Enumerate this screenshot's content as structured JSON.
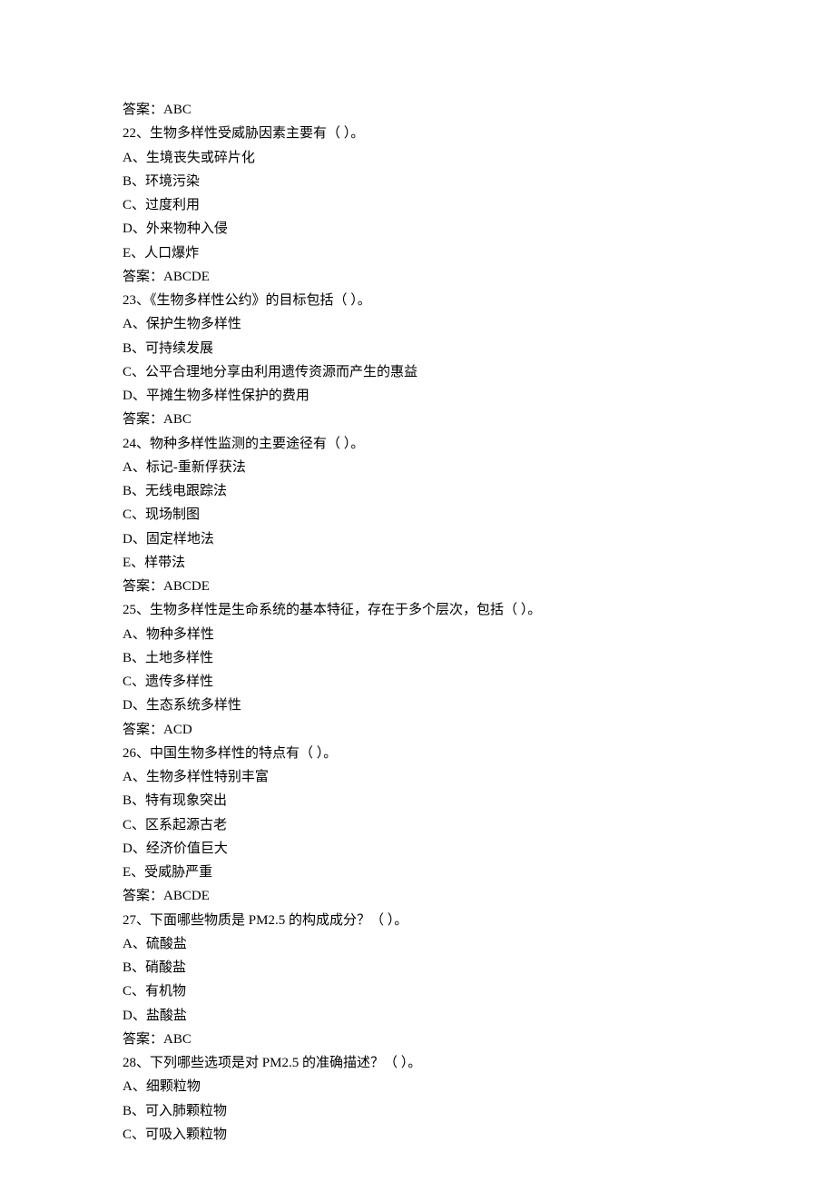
{
  "lines": [
    {
      "text": "答案：ABC"
    },
    {
      "text": "22、生物多样性受威胁因素主要有（ ）。"
    },
    {
      "text": "A、生境丧失或碎片化"
    },
    {
      "text": "B、环境污染"
    },
    {
      "text": "C、过度利用"
    },
    {
      "text": "D、外来物种入侵"
    },
    {
      "text": "E、人口爆炸"
    },
    {
      "text": "答案：ABCDE"
    },
    {
      "text": "23、《生物多样性公约》的目标包括（ ）。"
    },
    {
      "text": "A、保护生物多样性"
    },
    {
      "text": "B、可持续发展"
    },
    {
      "text": "C、公平合理地分享由利用遗传资源而产生的惠益"
    },
    {
      "text": "D、平摊生物多样性保护的费用"
    },
    {
      "text": "答案：ABC"
    },
    {
      "text": "24、物种多样性监测的主要途径有（ ）。"
    },
    {
      "text": "A、标记-重新俘获法"
    },
    {
      "text": "B、无线电跟踪法"
    },
    {
      "text": "C、现场制图"
    },
    {
      "text": "D、固定样地法"
    },
    {
      "text": "E、样带法"
    },
    {
      "text": "答案：ABCDE"
    },
    {
      "text": "25、生物多样性是生命系统的基本特征，存在于多个层次，包括（ ）。"
    },
    {
      "text": "A、物种多样性"
    },
    {
      "text": "B、土地多样性"
    },
    {
      "text": "C、遗传多样性"
    },
    {
      "text": "D、生态系统多样性"
    },
    {
      "text": "答案：ACD"
    },
    {
      "text": "26、中国生物多样性的特点有（ ）。"
    },
    {
      "text": "A、生物多样性特别丰富"
    },
    {
      "text": "B、特有现象突出"
    },
    {
      "text": "C、区系起源古老"
    },
    {
      "text": "D、经济价值巨大"
    },
    {
      "text": "E、受威胁严重"
    },
    {
      "text": "答案：ABCDE"
    },
    {
      "text": "27、下面哪些物质是 PM2.5 的构成成分？（ ）。"
    },
    {
      "text": "A、硫酸盐"
    },
    {
      "text": "B、硝酸盐"
    },
    {
      "text": "C、有机物"
    },
    {
      "text": "D、盐酸盐"
    },
    {
      "text": "答案：ABC"
    },
    {
      "text": "28、下列哪些选项是对 PM2.5 的准确描述？（ ）。"
    },
    {
      "text": "A、细颗粒物"
    },
    {
      "text": "B、可入肺颗粒物"
    },
    {
      "text": "C、可吸入颗粒物"
    }
  ]
}
